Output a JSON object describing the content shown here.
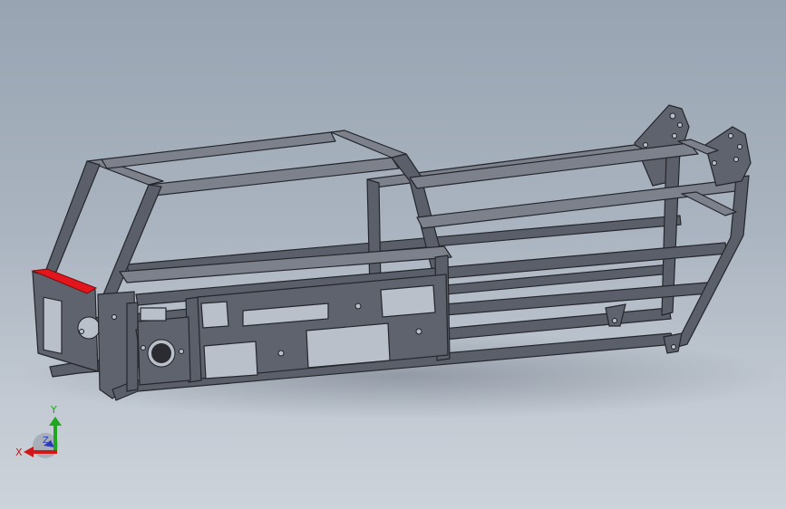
{
  "triad": {
    "x_label": "X",
    "y_label": "Y",
    "z_label": "Z",
    "x_color": "#d01818",
    "y_color": "#1fa81f",
    "z_color": "#2b3bb8"
  },
  "model": {
    "frame_color": "#5b5f69",
    "selected_edge_color": "#e2161c"
  }
}
